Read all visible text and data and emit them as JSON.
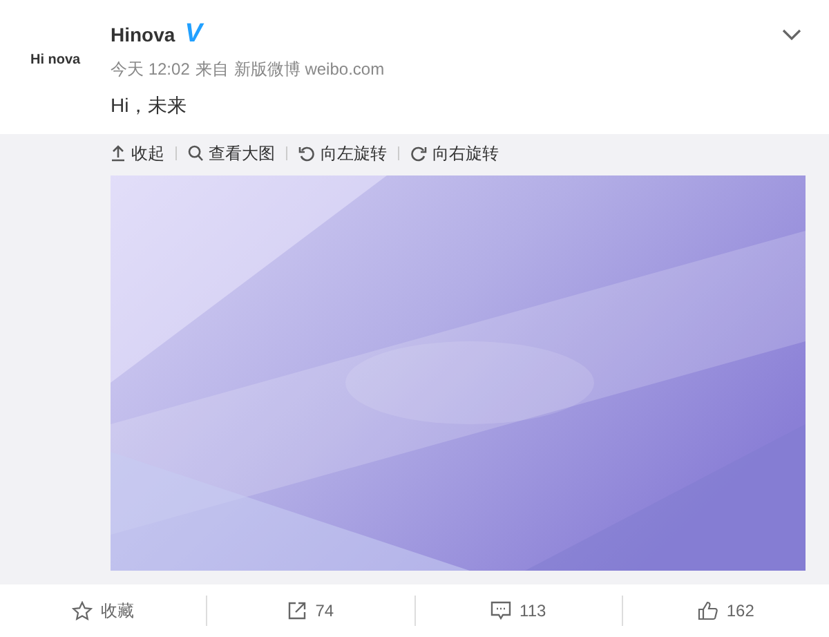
{
  "post": {
    "avatar_text": "Hi nova",
    "author": "Hinova",
    "verified_mark": "V",
    "time": "今天 12:02",
    "source_prefix": "来自",
    "source": "新版微博 weibo.com",
    "text": "Hi，未来"
  },
  "media_toolbar": [
    {
      "kind": "collapse",
      "label": "收起"
    },
    {
      "kind": "zoom",
      "label": "查看大图"
    },
    {
      "kind": "rotate-left",
      "label": "向左旋转"
    },
    {
      "kind": "rotate-right",
      "label": "向右旋转"
    }
  ],
  "actions": [
    {
      "kind": "favorite",
      "label": "收藏"
    },
    {
      "kind": "repost",
      "label": "74"
    },
    {
      "kind": "comment",
      "label": "113"
    },
    {
      "kind": "like",
      "label": "162"
    }
  ]
}
